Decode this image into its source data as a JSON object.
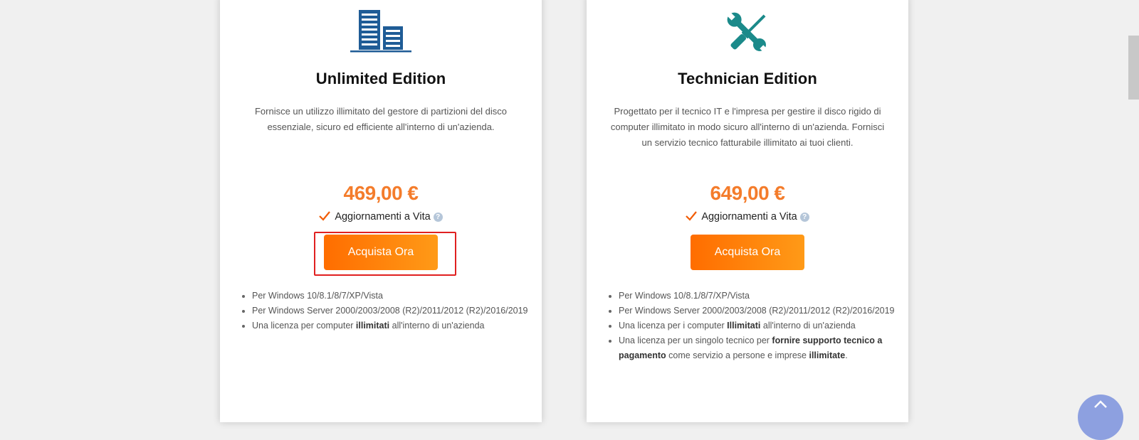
{
  "cards": [
    {
      "icon": "building-icon",
      "title": "Unlimited Edition",
      "description": "Fornisce un utilizzo illimitato del gestore di partizioni del disco essenziale, sicuro ed efficiente all'interno di un'azienda.",
      "price": "469,00 €",
      "update_label": "Aggiornamenti a Vita",
      "help_glyph": "?",
      "button_label": "Acquista Ora",
      "features": [
        {
          "parts": [
            {
              "text": "Per Windows 10/8.1/8/7/XP/Vista"
            }
          ]
        },
        {
          "parts": [
            {
              "text": "Per Windows Server 2000/2003/2008 (R2)/2011/2012 (R2)/2016/2019"
            }
          ]
        },
        {
          "parts": [
            {
              "text": "Una licenza per computer "
            },
            {
              "text": "illimitati",
              "bold": true
            },
            {
              "text": " all'interno di un'azienda"
            }
          ]
        }
      ]
    },
    {
      "icon": "tools-icon",
      "title": "Technician Edition",
      "description": "Progettato per il tecnico IT e l'impresa per gestire il disco rigido di computer illimitato in modo sicuro all'interno di un'azienda. Fornisci un servizio tecnico fatturabile illimitato ai tuoi clienti.",
      "price": "649,00 €",
      "update_label": "Aggiornamenti a Vita",
      "help_glyph": "?",
      "button_label": "Acquista Ora",
      "features": [
        {
          "parts": [
            {
              "text": "Per Windows 10/8.1/8/7/XP/Vista"
            }
          ]
        },
        {
          "parts": [
            {
              "text": "Per Windows Server 2000/2003/2008 (R2)/2011/2012 (R2)/2016/2019"
            }
          ]
        },
        {
          "parts": [
            {
              "text": "Una licenza per i computer "
            },
            {
              "text": "Illimitati",
              "bold": true
            },
            {
              "text": " all'interno di un'azienda"
            }
          ]
        },
        {
          "parts": [
            {
              "text": "Una licenza per un singolo tecnico per "
            },
            {
              "text": "fornire supporto tecnico a pagamento",
              "bold": true
            },
            {
              "text": " come servizio a persone e imprese "
            },
            {
              "text": "illimitate",
              "bold": true
            },
            {
              "text": "."
            }
          ]
        }
      ]
    }
  ],
  "colors": {
    "price": "#f47c2b",
    "button_start": "#ff6d00",
    "button_end": "#ff9a17",
    "building_icon": "#1f5c96",
    "tools_icon": "#1b8a8a",
    "check": "#f25c05",
    "highlight": "#e02020"
  }
}
